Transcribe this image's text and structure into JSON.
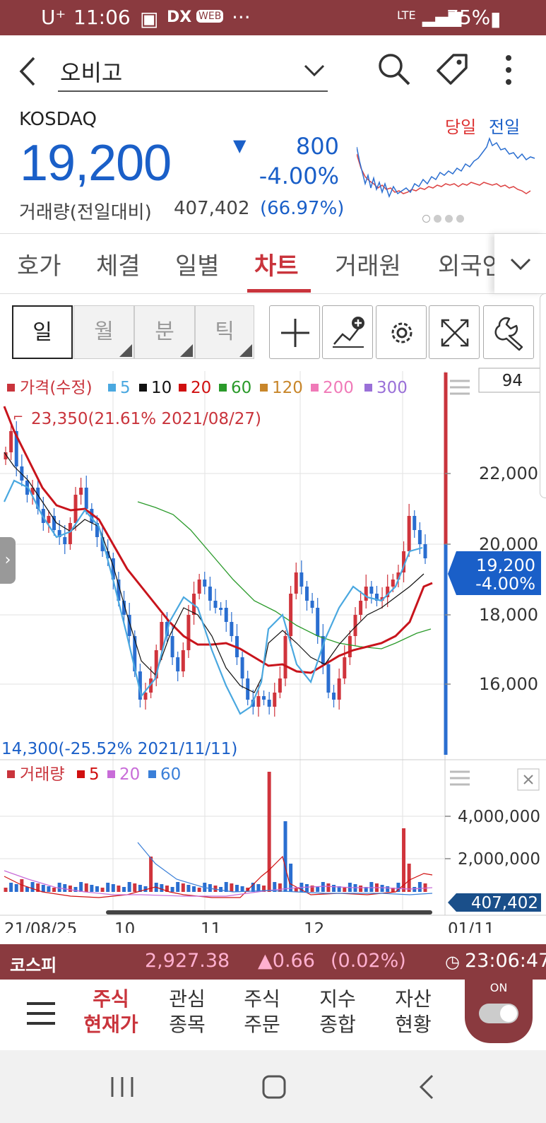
{
  "status_bar": {
    "carrier": "U⁺",
    "time": "11:06",
    "network": "LTE",
    "battery": "75%"
  },
  "header": {
    "stock_name": "오비고"
  },
  "quote": {
    "market": "KOSDAQ",
    "price": "19,200",
    "change": "800",
    "change_pct": "-4.00%",
    "volume_label": "거래량(전일대비)",
    "volume": "407,402",
    "volume_ratio": "(66.97%)",
    "legend_today": "당일",
    "legend_prev": "전일"
  },
  "tabs": [
    "호가",
    "체결",
    "일별",
    "차트",
    "거래원",
    "외국인"
  ],
  "active_tab": "차트",
  "period_buttons": [
    "일",
    "월",
    "분",
    "틱"
  ],
  "chart_legend": {
    "price": "가격(수정)",
    "ma": [
      "5",
      "10",
      "20",
      "60",
      "120",
      "200",
      "300"
    ],
    "ma_colors": [
      "#4aa8e0",
      "#111111",
      "#d01010",
      "#2a9a2a",
      "#c8862a",
      "#f07ab8",
      "#9a70d8"
    ]
  },
  "chart_count": "94",
  "annotations": {
    "high": "23,350(21.61% 2021/08/27)",
    "low": "14,300(-25.52% 2021/11/11)"
  },
  "current_price_tag": {
    "price": "19,200",
    "pct": "-4.00%"
  },
  "volume_legend": {
    "label": "거래량",
    "ma": [
      "5",
      "20",
      "60"
    ],
    "ma_colors": [
      "#d01010",
      "#c86cd8",
      "#3a7fd8"
    ]
  },
  "volume_tag": "407,402",
  "x_axis": [
    "21/08/25",
    "10",
    "11",
    "12",
    "01/11"
  ],
  "bottom_index": {
    "name": "코스피",
    "value": "2,927.38",
    "change": "▲0.66",
    "pct": "(0.02%)",
    "time": "23:06:47"
  },
  "nav": [
    {
      "line1": "주식",
      "line2": "현재가"
    },
    {
      "line1": "관심",
      "line2": "종목"
    },
    {
      "line1": "주식",
      "line2": "주문"
    },
    {
      "line1": "지수",
      "line2": "종합"
    },
    {
      "line1": "자산",
      "line2": "현황"
    }
  ],
  "toggle_label": "ON",
  "chart_data": {
    "type": "candlestick",
    "y_ticks": [
      "22,000",
      "20,000",
      "18,000",
      "16,000"
    ],
    "ylim": [
      14000,
      23600
    ],
    "volume_ticks": [
      "4,000,000",
      "2,000,000"
    ],
    "volume_ylim": [
      0,
      6000000
    ],
    "x": [
      "21/08/25",
      "10",
      "11",
      "12",
      "01/11"
    ],
    "series": [
      {
        "name": "가격(수정)",
        "high": 23350,
        "low": 14300,
        "last": 19200
      },
      {
        "name": "거래량",
        "last": 407402
      }
    ]
  }
}
